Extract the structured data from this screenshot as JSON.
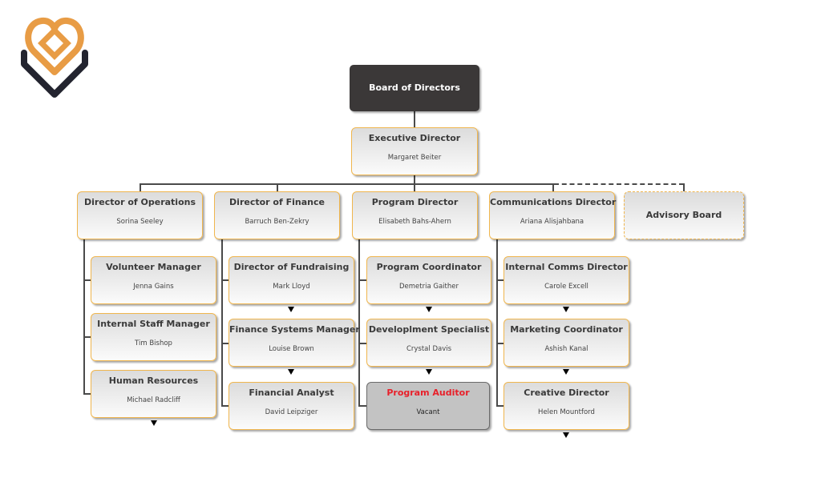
{
  "logo": {
    "icon": "heart-diamond-logo",
    "colors": {
      "primary": "#e89c45",
      "secondary": "#23242f"
    }
  },
  "board": {
    "title": "Board of Directors"
  },
  "executive": {
    "title": "Executive Director",
    "name": "Margaret Beiter"
  },
  "directors": [
    {
      "title": "Director of Operations",
      "name": "Sorina Seeley"
    },
    {
      "title": "Director of Finance",
      "name": "Barruch Ben-Zekry"
    },
    {
      "title": "Program Director",
      "name": "Elisabeth Bahs-Ahern"
    },
    {
      "title": "Communications Director",
      "name": "Ariana Alisjahbana"
    }
  ],
  "advisory": {
    "title": "Advisory Board"
  },
  "operations_team": [
    {
      "title": "Volunteer Manager",
      "name": "Jenna Gains"
    },
    {
      "title": "Internal Staff Manager",
      "name": "Tim Bishop"
    },
    {
      "title": "Human Resources",
      "name": "Michael Radcliff"
    }
  ],
  "finance_team": [
    {
      "title": "Director of Fundraising",
      "name": "Mark Lloyd"
    },
    {
      "title": "Finance Systems Manager",
      "name": "Louise Brown"
    },
    {
      "title": "Financial Analyst",
      "name": "David Leipziger"
    }
  ],
  "program_team": [
    {
      "title": "Program Coordinator",
      "name": "Demetria Gaither"
    },
    {
      "title": "Developlment Specialist",
      "name": "Crystal Davis"
    },
    {
      "title": "Program Auditor",
      "name": "Vacant"
    }
  ],
  "communications_team": [
    {
      "title": "Internal Comms Director",
      "name": "Carole Excell"
    },
    {
      "title": "Marketing Coordinator",
      "name": "Ashish Kanal"
    },
    {
      "title": "Creative Director",
      "name": "Helen Mountford"
    }
  ],
  "colors": {
    "accent_border": "#f0b64e",
    "dark_box": "#3b3838",
    "vacant_title": "#e8202a",
    "vacant_fill": "#c3c3c3"
  }
}
